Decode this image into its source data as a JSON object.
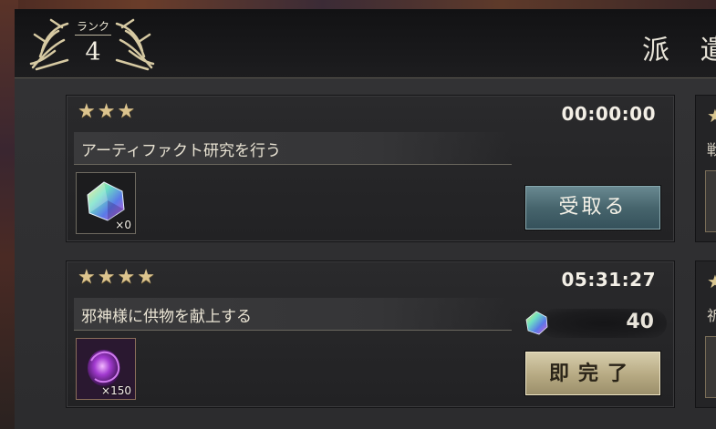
{
  "header": {
    "rank_label": "ランク",
    "rank_value": "4",
    "title": "派 遣"
  },
  "missions": [
    {
      "stars": 3,
      "timer": "00:00:00",
      "title": "アーティファクト研究を行う",
      "reward": {
        "icon": "rainbow-crystal-icon",
        "count": "×0"
      },
      "button": "受取る"
    },
    {
      "stars": 4,
      "timer": "05:31:27",
      "title": "邪神様に供物を献上する",
      "reward": {
        "icon": "purple-orb-icon",
        "count": "×150"
      },
      "cost": {
        "icon": "rainbow-crystal-icon",
        "value": "40"
      },
      "button": "即完了"
    }
  ],
  "peek_cards": [
    {
      "first_char": "戦"
    },
    {
      "first_char": "祈"
    }
  ],
  "colors": {
    "star": "#dcc48e",
    "receive_button": "#47656d",
    "instant_button": "#b6a982"
  }
}
